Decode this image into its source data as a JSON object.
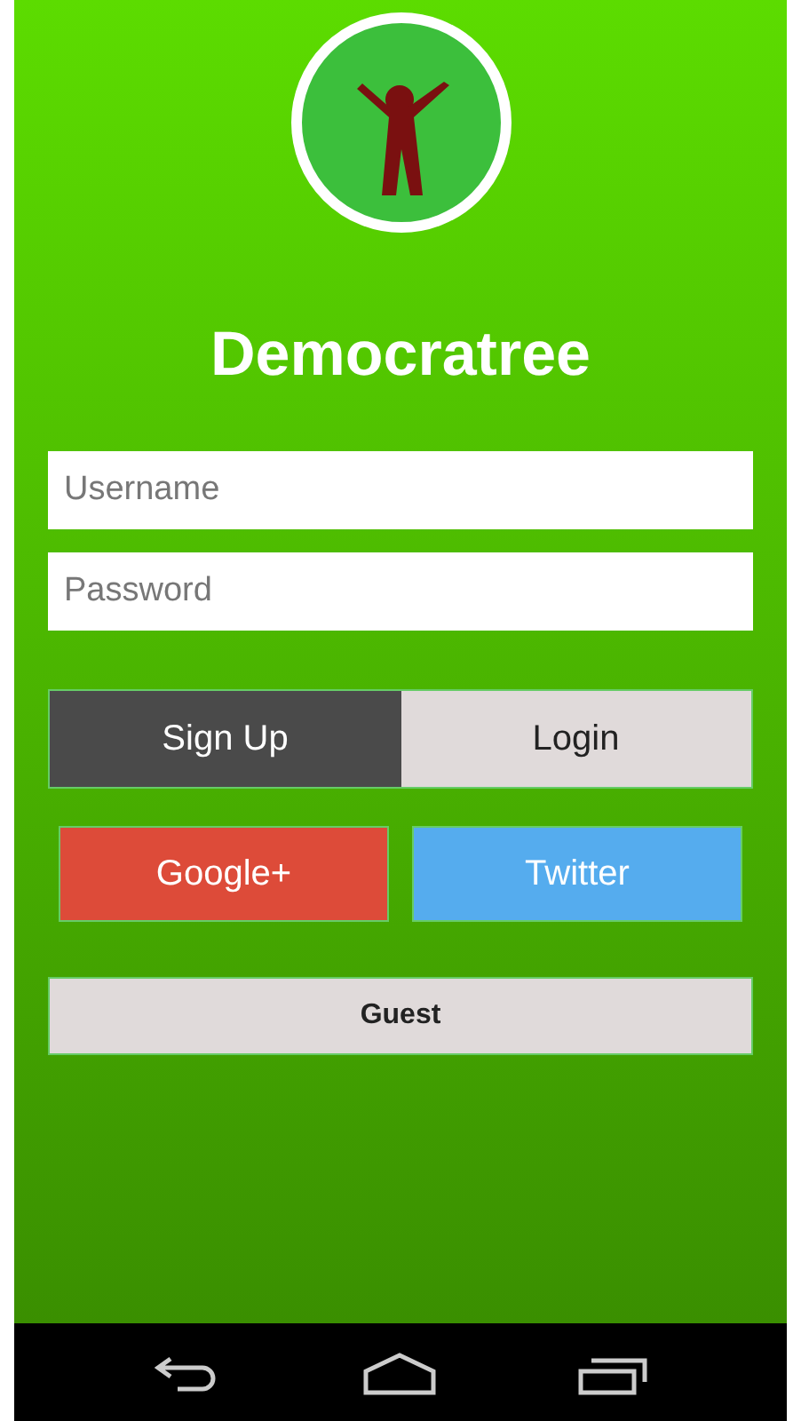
{
  "app": {
    "title": "Democratree"
  },
  "fields": [
    {
      "placeholder": "Username"
    },
    {
      "placeholder": "Password"
    }
  ],
  "mode_toggle": [
    {
      "label": "Sign Up",
      "selected": true
    },
    {
      "label": "Login",
      "selected": false
    }
  ],
  "social_buttons": [
    {
      "label": "Google+",
      "color": "#dd4b39"
    },
    {
      "label": "Twitter",
      "color": "#55acee"
    }
  ],
  "guest_button": {
    "label": "Guest"
  }
}
